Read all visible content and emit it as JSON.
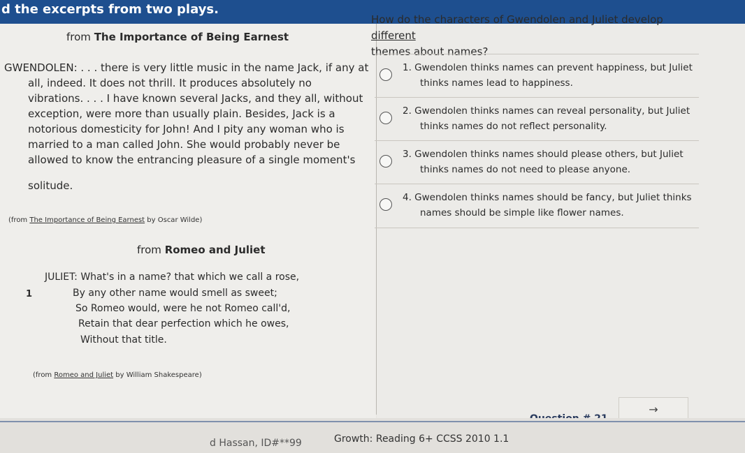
{
  "header": {
    "instruction": "d the excerpts from two plays."
  },
  "excerpt1": {
    "title_prefix": "from ",
    "title_bold": "The Importance of Being Earnest",
    "lines": [
      "GWENDOLEN: . . . there is very little music in the name Jack, if any at",
      "all, indeed. It does not thrill. It produces absolutely no",
      "vibrations. . . . I have known several Jacks, and they all, without",
      "exception, were more than usually plain. Besides, Jack is a",
      "notorious domesticity for John! And I pity any woman who is",
      "married to a man called John. She would probably never be",
      "allowed to know the entrancing pleasure of a single moment's",
      "solitude."
    ],
    "source_prefix": "(from ",
    "source_title": "The Importance of Being Earnest",
    "source_suffix": " by Oscar Wilde)"
  },
  "excerpt2": {
    "title_prefix": "from ",
    "title_bold": "Romeo and Juliet",
    "line_number": "1",
    "lines": [
      "JULIET: What's in a name? that which we call a rose,",
      "By any other name would smell as sweet;",
      "So Romeo would, were he not Romeo call'd,",
      "Retain that dear perfection which he owes,",
      "Without that title."
    ],
    "source_prefix": "(from ",
    "source_title": "Romeo and Juliet",
    "source_suffix": " by William Shakespeare)"
  },
  "question": {
    "text_part1": "How do the characters of Gwendolen and Juliet develop ",
    "text_underlined": "different",
    "text_part2": "themes about names?",
    "options": [
      {
        "line1": "1.  Gwendolen thinks names can prevent happiness, but Juliet",
        "line2": "thinks names lead to happiness."
      },
      {
        "line1": "2.  Gwendolen thinks names can reveal personality, but Juliet",
        "line2": "thinks names do not reflect personality."
      },
      {
        "line1": "3.  Gwendolen thinks names should please others, but Juliet",
        "line2": "thinks names do not need to please anyone."
      },
      {
        "line1": "4.  Gwendolen thinks names should be fancy, but Juliet thinks",
        "line2": "names should be simple like flower names."
      }
    ]
  },
  "footer": {
    "student": "d Hassan, ID#**99",
    "growth": "Growth: Reading 6+ CCSS 2010 1.1",
    "question_number": "Question # 21",
    "next_arrow": "→"
  }
}
